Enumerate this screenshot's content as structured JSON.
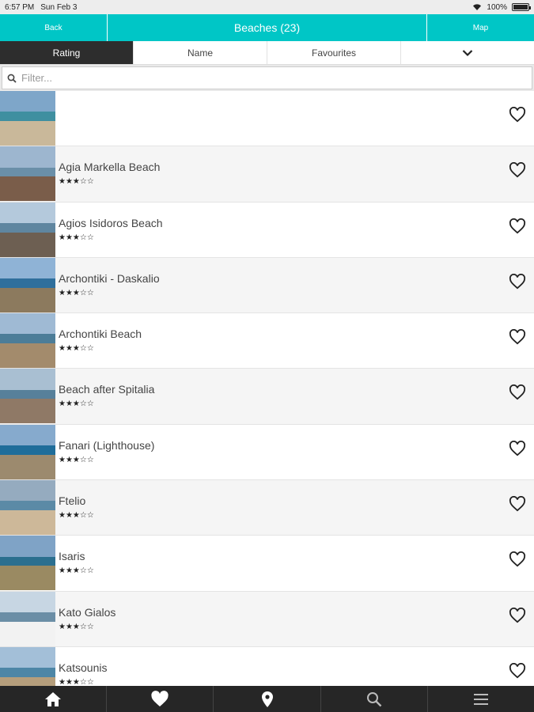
{
  "status": {
    "time": "6:57 PM",
    "date": "Sun Feb 3",
    "battery": "100%",
    "wifi_icon": "wifi-icon"
  },
  "nav": {
    "back_label": "Back",
    "title": "Beaches (23)",
    "map_label": "Map"
  },
  "sort_tabs": [
    {
      "label": "Rating",
      "active": true
    },
    {
      "label": "Name",
      "active": false
    },
    {
      "label": "Favourites",
      "active": false
    },
    {
      "label": "",
      "icon": "chevron-down-icon"
    }
  ],
  "filter": {
    "placeholder": "Filter...",
    "value": ""
  },
  "beaches": [
    {
      "name": "",
      "stars": ""
    },
    {
      "name": "Agia Markella Beach",
      "stars": "★★★☆☆"
    },
    {
      "name": "Agios Isidoros Beach",
      "stars": "★★★☆☆"
    },
    {
      "name": "Archontiki - Daskalio",
      "stars": "★★★☆☆"
    },
    {
      "name": "Archontiki Beach",
      "stars": "★★★☆☆"
    },
    {
      "name": "Beach after Spitalia",
      "stars": "★★★☆☆"
    },
    {
      "name": "Fanari (Lighthouse)",
      "stars": "★★★☆☆"
    },
    {
      "name": "Ftelio",
      "stars": "★★★☆☆"
    },
    {
      "name": "Isaris",
      "stars": "★★★☆☆"
    },
    {
      "name": "Kato Gialos",
      "stars": "★★★☆☆"
    },
    {
      "name": "Katsounis",
      "stars": "★★★☆☆"
    }
  ],
  "tab_bar": [
    {
      "icon": "home-icon"
    },
    {
      "icon": "heart-icon"
    },
    {
      "icon": "map-pin-icon"
    },
    {
      "icon": "search-icon"
    },
    {
      "icon": "menu-icon"
    }
  ],
  "colors": {
    "accent": "#00c6c6",
    "dark": "#262626"
  }
}
